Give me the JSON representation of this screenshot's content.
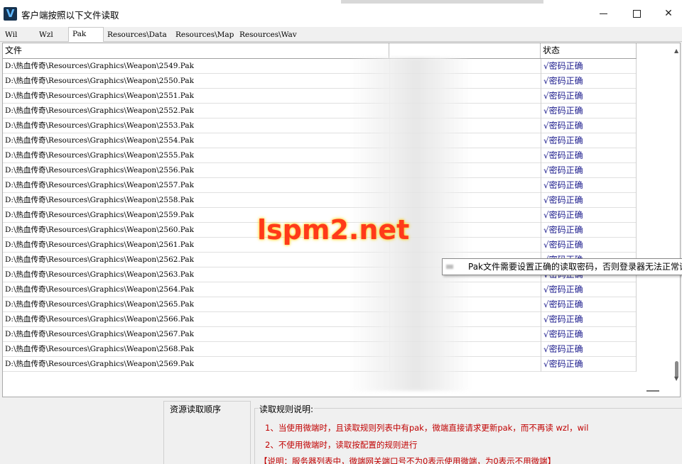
{
  "window": {
    "title": "客户端按照以下文件读取",
    "icon_letter": "V"
  },
  "tabs": [
    {
      "label": "Wil",
      "active": false
    },
    {
      "label": "Wzl",
      "active": false
    },
    {
      "label": "Pak",
      "active": true
    },
    {
      "label": "Resources\\Data",
      "active": false
    },
    {
      "label": "Resources\\Map",
      "active": false
    },
    {
      "label": "Resources\\Wav",
      "active": false
    }
  ],
  "table": {
    "headers": {
      "file": "文件",
      "password": "",
      "status": "状态"
    },
    "rows": [
      {
        "file": "D:\\热血传奇\\Resources\\Graphics\\Weapon\\2549.Pak",
        "status": "√密码正确"
      },
      {
        "file": "D:\\热血传奇\\Resources\\Graphics\\Weapon\\2550.Pak",
        "status": "√密码正确"
      },
      {
        "file": "D:\\热血传奇\\Resources\\Graphics\\Weapon\\2551.Pak",
        "status": "√密码正确"
      },
      {
        "file": "D:\\热血传奇\\Resources\\Graphics\\Weapon\\2552.Pak",
        "status": "√密码正确"
      },
      {
        "file": "D:\\热血传奇\\Resources\\Graphics\\Weapon\\2553.Pak",
        "status": "√密码正确"
      },
      {
        "file": "D:\\热血传奇\\Resources\\Graphics\\Weapon\\2554.Pak",
        "status": "√密码正确"
      },
      {
        "file": "D:\\热血传奇\\Resources\\Graphics\\Weapon\\2555.Pak",
        "status": "√密码正确"
      },
      {
        "file": "D:\\热血传奇\\Resources\\Graphics\\Weapon\\2556.Pak",
        "status": "√密码正确"
      },
      {
        "file": "D:\\热血传奇\\Resources\\Graphics\\Weapon\\2557.Pak",
        "status": "√密码正确"
      },
      {
        "file": "D:\\热血传奇\\Resources\\Graphics\\Weapon\\2558.Pak",
        "status": "√密码正确"
      },
      {
        "file": "D:\\热血传奇\\Resources\\Graphics\\Weapon\\2559.Pak",
        "status": "√密码正确"
      },
      {
        "file": "D:\\热血传奇\\Resources\\Graphics\\Weapon\\2560.Pak",
        "status": "√密码正确"
      },
      {
        "file": "D:\\热血传奇\\Resources\\Graphics\\Weapon\\2561.Pak",
        "status": "√密码正确"
      },
      {
        "file": "D:\\热血传奇\\Resources\\Graphics\\Weapon\\2562.Pak",
        "status": "√密码正确"
      },
      {
        "file": "D:\\热血传奇\\Resources\\Graphics\\Weapon\\2563.Pak",
        "status": "√密码正确"
      },
      {
        "file": "D:\\热血传奇\\Resources\\Graphics\\Weapon\\2564.Pak",
        "status": "√密码正确"
      },
      {
        "file": "D:\\热血传奇\\Resources\\Graphics\\Weapon\\2565.Pak",
        "status": "√密码正确"
      },
      {
        "file": "D:\\热血传奇\\Resources\\Graphics\\Weapon\\2566.Pak",
        "status": "√密码正确"
      },
      {
        "file": "D:\\热血传奇\\Resources\\Graphics\\Weapon\\2567.Pak",
        "status": "√密码正确"
      },
      {
        "file": "D:\\热血传奇\\Resources\\Graphics\\Weapon\\2568.Pak",
        "status": "√密码正确"
      },
      {
        "file": "D:\\热血传奇\\Resources\\Graphics\\Weapon\\2569.Pak",
        "status": "√密码正确"
      }
    ]
  },
  "tooltip": "Pak文件需要设置正确的读取密码，否则登录器无法正常读取",
  "watermark": "lspm2.net",
  "bottom": {
    "order_label": "资源读取顺序",
    "rules_label": "读取规则说明:",
    "rules": [
      "1、当使用微端时，且读取规则列表中有pak，微端直接请求更新pak，而不再读 wzl，wil",
      "2、不使用微端时，读取按配置的规则进行",
      "【说明：服务器列表中，微端网关端口号不为0表示使用微端，为0表示不用微端】"
    ]
  },
  "colors": {
    "status_text": "#1a1a8c",
    "rule_text": "#c00000",
    "watermark": "#ff3a1a"
  }
}
